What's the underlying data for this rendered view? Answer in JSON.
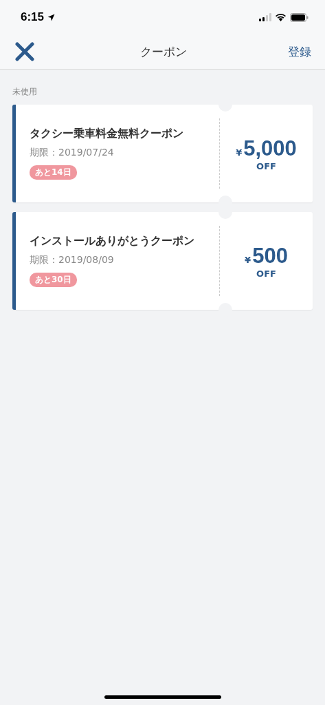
{
  "status_bar": {
    "time": "6:15"
  },
  "nav": {
    "title": "クーポン",
    "action": "登録"
  },
  "section": {
    "label": "未使用"
  },
  "coupons": [
    {
      "title": "タクシー乗車料金無料クーポン",
      "expiry": "期限：2019/07/24",
      "remaining": "あと14日",
      "currency": "¥",
      "amount": "5,000",
      "unit": "OFF"
    },
    {
      "title": "インストールありがとうクーポン",
      "expiry": "期限：2019/08/09",
      "remaining": "あと30日",
      "currency": "¥",
      "amount": "500",
      "unit": "OFF"
    }
  ]
}
